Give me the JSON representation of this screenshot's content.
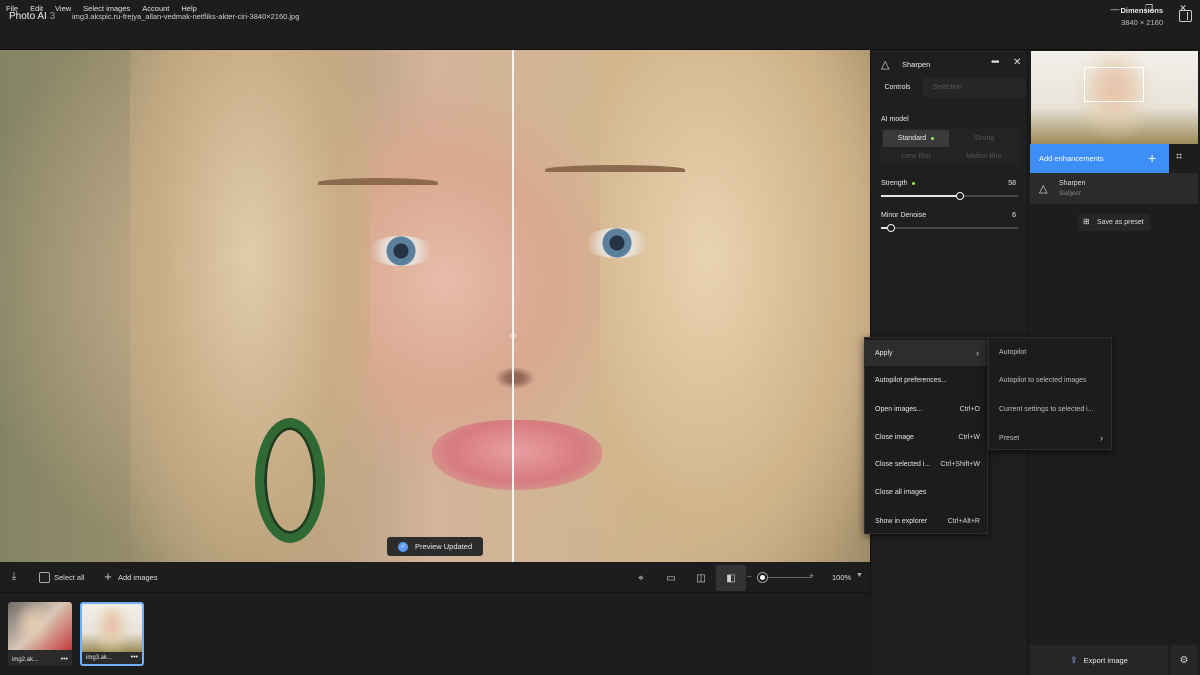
{
  "menubar": {
    "items": [
      "File",
      "Edit",
      "View",
      "Select images",
      "Account",
      "Help"
    ],
    "window_controls": {
      "minimize": "—",
      "maximize": "❐",
      "close": "✕"
    }
  },
  "header": {
    "app_name": "Photo AI",
    "app_version": "3",
    "filename": "img3.akspic.ru-frejya_allan-vedmak-netfliks-akter-ciri-3840×2160.jpg",
    "dimensions_label": "Dimensions",
    "dimensions_value": "3840 × 2160"
  },
  "canvas": {
    "toast_text": "Preview Updated"
  },
  "bottom_toolbar": {
    "select_all": "Select all",
    "add_images": "Add images",
    "zoom_value": "100%"
  },
  "filmstrip": [
    {
      "label": "img2.ak...",
      "selected": false
    },
    {
      "label": "img3.ak...",
      "selected": true
    }
  ],
  "sharpen_panel": {
    "title": "Sharpen",
    "tabs": {
      "controls": "Controls",
      "selection": "Selection"
    },
    "ai_model_label": "AI model",
    "models": {
      "standard": "Standard",
      "strong": "Strong",
      "lens_blur": "Lens Blur",
      "motion_blur": "Motion Blur"
    },
    "selected_model": "Standard",
    "strength": {
      "label": "Strength",
      "value": "58"
    },
    "minor_denoise": {
      "label": "Minor Denoise",
      "value": "6"
    }
  },
  "right_panel": {
    "add_enhancements": "Add enhancements",
    "enhancement": {
      "name": "Sharpen",
      "subtitle": "Subject"
    },
    "save_preset": "Save as preset",
    "export": "Export image"
  },
  "context_menu": {
    "items": [
      {
        "label": "Apply",
        "shortcut": "",
        "submenu": true
      },
      {
        "label": "Autopilot preferences...",
        "shortcut": ""
      },
      {
        "label": "Open images...",
        "shortcut": "Ctrl+O"
      },
      {
        "label": "Close image",
        "shortcut": "Ctrl+W"
      },
      {
        "label": "Close selected i...",
        "shortcut": "Ctrl+Shift+W"
      },
      {
        "label": "Close all images",
        "shortcut": ""
      },
      {
        "label": "Show in explorer",
        "shortcut": "Ctrl+Alt+R"
      }
    ],
    "submenu": [
      {
        "label": "Autopilot"
      },
      {
        "label": "Autopilot to selected images"
      },
      {
        "label": "Current settings to selected i..."
      },
      {
        "label": "Preset",
        "submenu": true
      }
    ]
  },
  "colors": {
    "accent": "#3e8ef7",
    "selected_thumb": "#6fb0ff",
    "model_indicator": "#9be55a"
  }
}
